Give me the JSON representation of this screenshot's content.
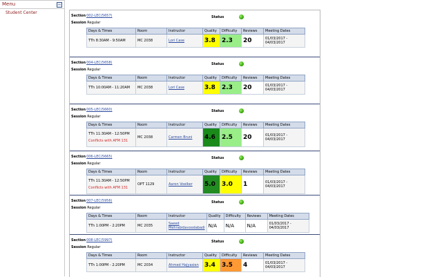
{
  "sidebar": {
    "menu_title": "Menu",
    "collapse_glyph": "−",
    "item": "Student Center"
  },
  "labels": {
    "section": "Section",
    "session": "Session",
    "status": "Status",
    "col_days": "Days & Times",
    "col_room": "Room",
    "col_instructor": "Instructor",
    "col_quality": "Quality",
    "col_difficulty": "Difficulty",
    "col_reviews": "Reviews",
    "col_dates": "Meeting Dates"
  },
  "colors": {
    "yellow": "#ffff00",
    "lightgreen": "#99ee88",
    "darkgreen": "#1a8a1a",
    "green": "#228b22",
    "orange": "#ff9933",
    "white": "#ffffff"
  },
  "sections": [
    {
      "section": "002-LEC(5657)",
      "session": "Regular",
      "days_times": "TTh 8:30AM - 9:50AM",
      "room": "MC   2038",
      "instructor": "Lori Case",
      "quality": "3.8",
      "quality_color": "#ffff00",
      "difficulty": "2.3",
      "difficulty_color": "#99ee88",
      "reviews": "20",
      "dates": "01/03/2017 - 04/03/2017",
      "conflict": ""
    },
    {
      "section": "004-LEC(5658)",
      "session": "Regular",
      "days_times": "TTh 10:00AM - 11:20AM",
      "room": "MC   2038",
      "instructor": "Lori Case",
      "quality": "3.8",
      "quality_color": "#ffff00",
      "difficulty": "2.3",
      "difficulty_color": "#99ee88",
      "reviews": "20",
      "dates": "01/03/2017 - 04/03/2017",
      "conflict": ""
    },
    {
      "section": "005-LEC(5660)",
      "session": "Regular",
      "days_times": "TTh 11:30AM - 12:50PM",
      "room": "MC   2038",
      "instructor": "Carmen Bruni",
      "quality": "4.6",
      "quality_color": "#1a8a1a",
      "difficulty": "2.5",
      "difficulty_color": "#99ee88",
      "reviews": "20",
      "dates": "01/03/2017 - 04/03/2017",
      "conflict": "Conflicts with AFM 131"
    },
    {
      "section": "006-LEC(5665)",
      "session": "Regular",
      "days_times": "TTh 11:30AM - 12:50PM",
      "room": "OPT  1129",
      "instructor": "Aaron Voelker",
      "quality": "5.0",
      "quality_color": "#228b22",
      "difficulty": "3.0",
      "difficulty_color": "#ffff00",
      "reviews": "1",
      "dates": "01/03/2017 - 04/03/2017",
      "conflict": "Conflicts with AFM 131"
    },
    {
      "section": "007-LEC(5956)",
      "session": "Regular",
      "days_times": "TTh 1:00PM - 2:20PM",
      "room": "MC   2035",
      "instructor": "Saeed Mehrabidavoodabadi",
      "quality": "N/A",
      "quality_color": "#ffffff",
      "difficulty": "N/A",
      "difficulty_color": "#ffffff",
      "reviews": "N/A",
      "dates": "01/03/2017 - 04/03/2017",
      "conflict": ""
    },
    {
      "section": "008-LEC(5997)",
      "session": "Regular",
      "days_times": "TTh 1:00PM - 2:20PM",
      "room": "MC   2034",
      "instructor": "Ahmed Hajyasien",
      "quality": "3.4",
      "quality_color": "#ffff00",
      "difficulty": "3.5",
      "difficulty_color": "#ff9933",
      "reviews": "4",
      "dates": "01/03/2017 - 04/03/2017",
      "conflict": ""
    }
  ]
}
